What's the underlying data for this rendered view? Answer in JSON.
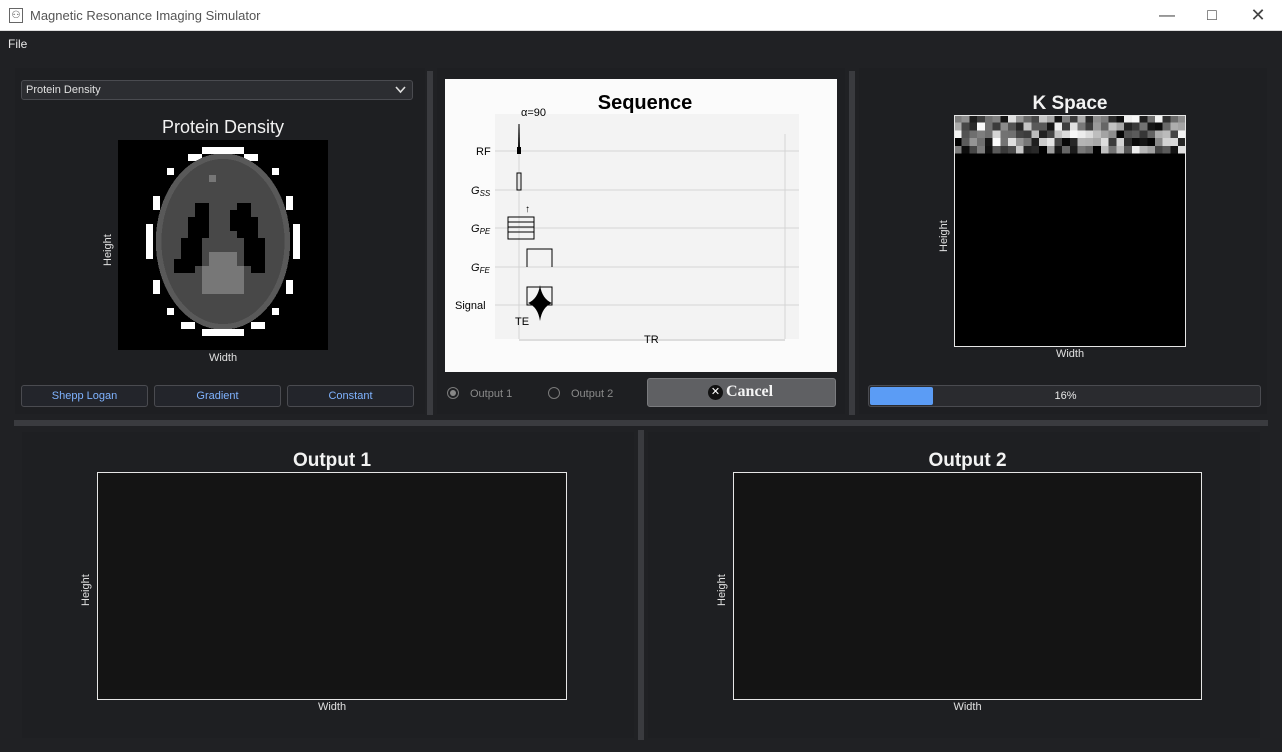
{
  "window": {
    "title": "Magnetic Resonance Imaging Simulator",
    "minimize_icon": "minimize-icon",
    "maximize_icon": "maximize-icon",
    "close_icon": "close-icon"
  },
  "menu": {
    "file": "File"
  },
  "phantom_panel": {
    "selected_option": "Protein Density",
    "plot_title": "Protein Density",
    "xlabel": "Width",
    "ylabel": "Height",
    "buttons": [
      "Shepp Logan",
      "Gradient",
      "Constant"
    ]
  },
  "sequence_panel": {
    "title": "Sequence",
    "flip_angle": "α=90",
    "rows": [
      "RF",
      "G",
      "G",
      "G",
      "Signal"
    ],
    "row_subscripts": [
      "",
      "SS",
      "PE",
      "FE",
      ""
    ],
    "te_label": "TE",
    "tr_label": "TR",
    "arrow": "↑",
    "radio_output1": "Output 1",
    "radio_output2": "Output 2",
    "selected_output": "Output 1",
    "cancel_label": "Cancel"
  },
  "kspace_panel": {
    "title": "K Space",
    "xlabel": "Width",
    "ylabel": "Height",
    "progress_percent": 16,
    "progress_text": "16%",
    "accent": "#5b9cf5"
  },
  "outputs": [
    {
      "title": "Output 1",
      "xlabel": "Width",
      "ylabel": "Height"
    },
    {
      "title": "Output 2",
      "xlabel": "Width",
      "ylabel": "Height"
    }
  ]
}
